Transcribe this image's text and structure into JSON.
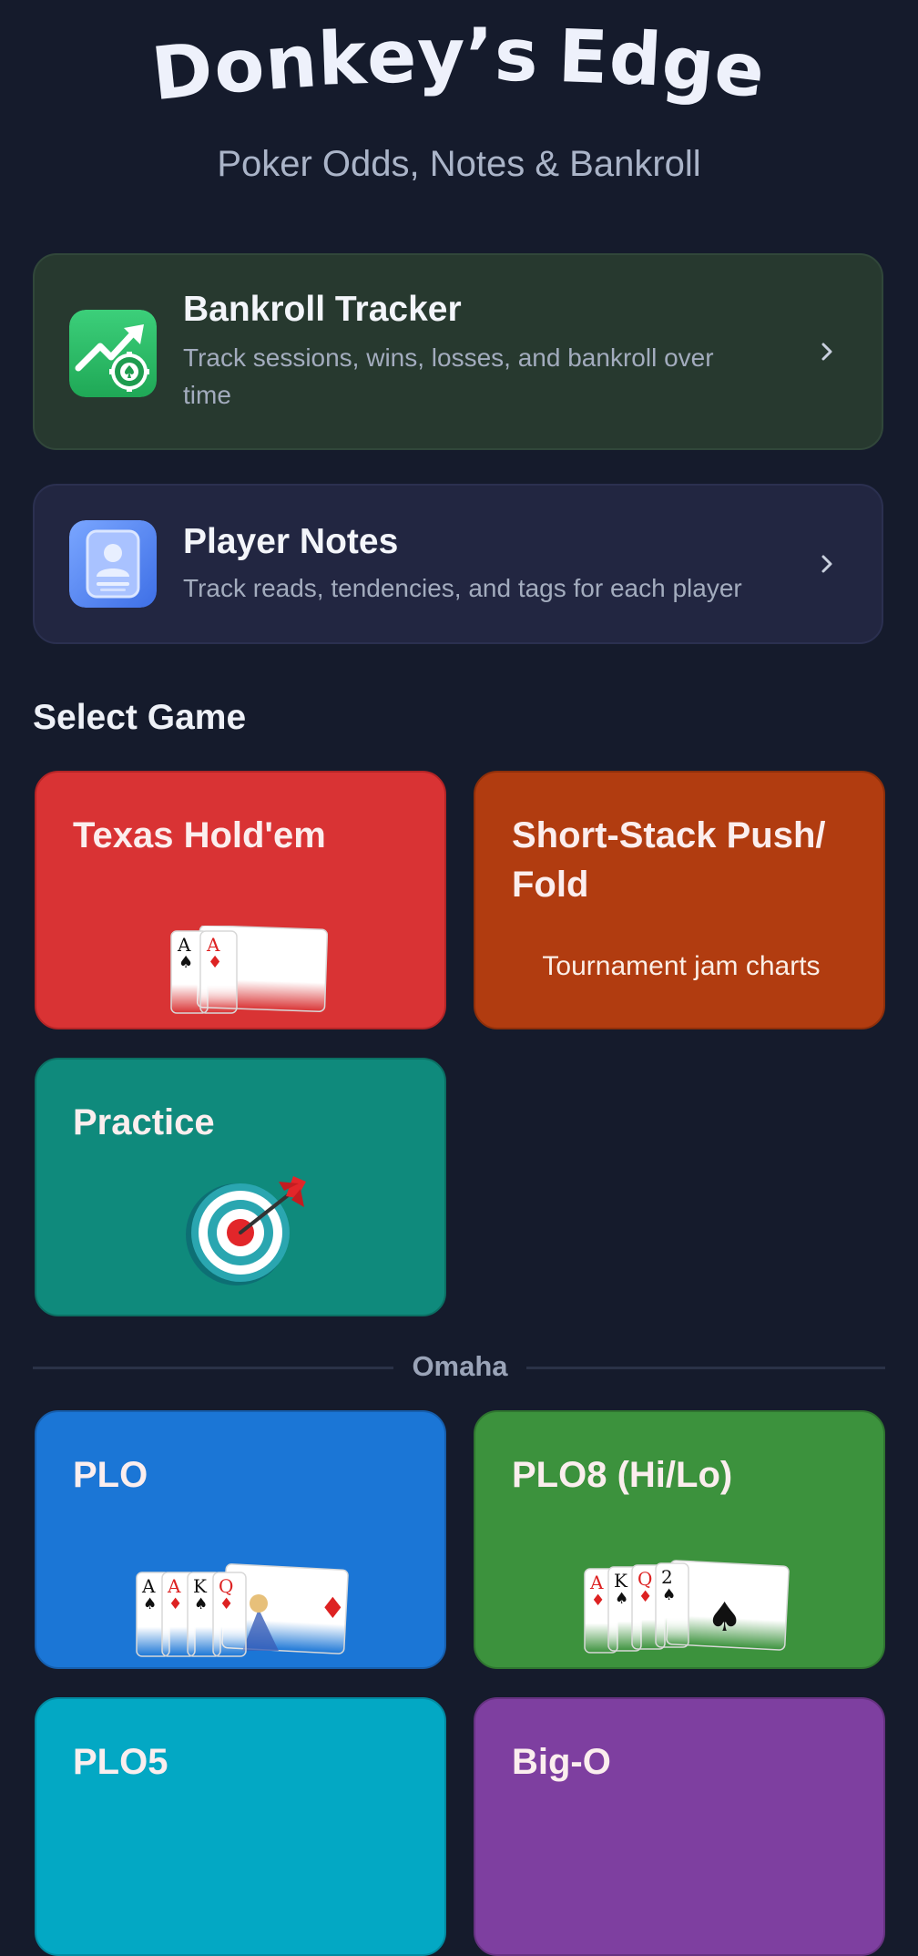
{
  "header": {
    "title_letters": [
      "D",
      "o",
      "n",
      "k",
      "e",
      "y",
      "’",
      "s",
      " ",
      "E",
      "d",
      "g",
      "e"
    ],
    "subtitle": "Poker Odds, Notes & Bankroll"
  },
  "features": {
    "bankroll": {
      "title": "Bankroll Tracker",
      "description": "Track sessions, wins, losses, and bankroll over time",
      "icon": "chart-up-chip-icon"
    },
    "notes": {
      "title": "Player Notes",
      "description": "Track reads, tendencies, and tags for each player",
      "icon": "player-card-icon"
    }
  },
  "games_section": {
    "title": "Select Game",
    "tiles": {
      "holdem": {
        "label": "Texas Hold'em",
        "color": "#d93334"
      },
      "shortstack": {
        "label": "Short-Stack Push/ Fold",
        "sublabel": "Tournament jam charts",
        "color": "#b13c10"
      },
      "practice": {
        "label": "Practice",
        "color": "#0f8a7c"
      }
    }
  },
  "omaha_section": {
    "divider_label": "Omaha",
    "tiles": {
      "plo": {
        "label": "PLO",
        "color": "#1b76d6"
      },
      "plo8": {
        "label": "PLO8 (Hi/Lo)",
        "color": "#3c923d"
      },
      "plo5": {
        "label": "PLO5",
        "color": "#03a8c4"
      },
      "bigo": {
        "label": "Big-O",
        "color": "#7e3fa0"
      }
    }
  },
  "cards": {
    "holdem": [
      "A",
      "A"
    ],
    "plo": [
      "A",
      "A",
      "K",
      "Q"
    ],
    "plo8": [
      "A",
      "K",
      "Q",
      "2"
    ]
  }
}
